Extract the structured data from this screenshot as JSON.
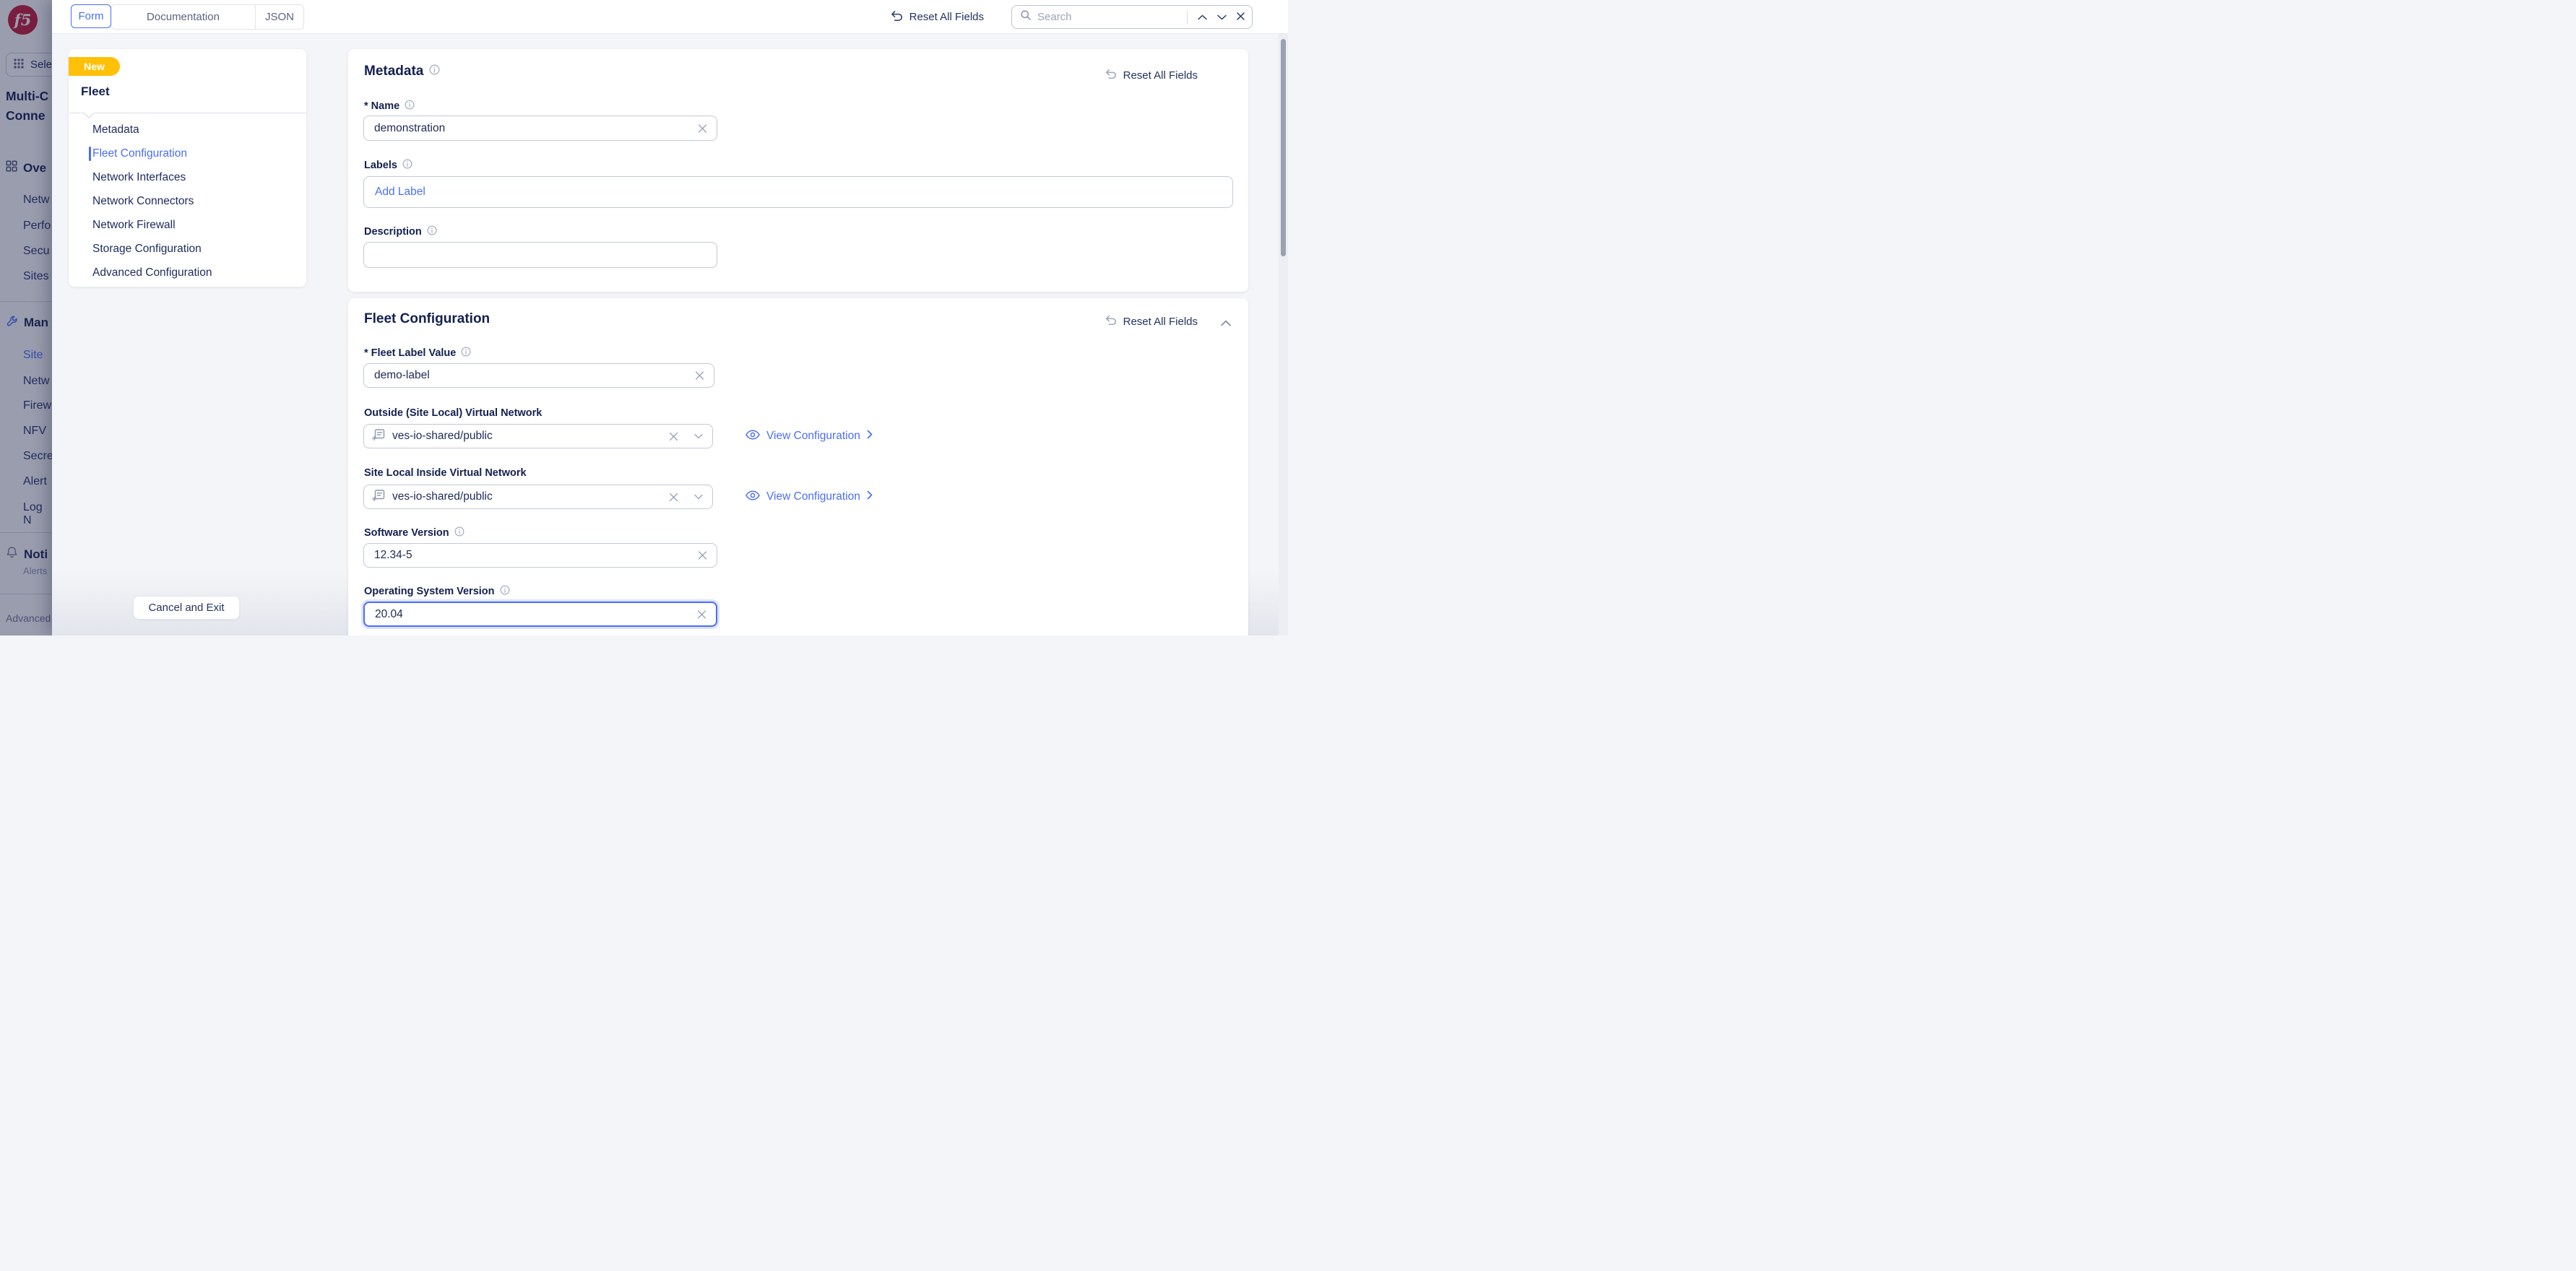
{
  "topbar": {
    "tabs": [
      {
        "label": "Form",
        "active": true
      },
      {
        "label": "Documentation",
        "active": false
      },
      {
        "label": "JSON",
        "active": false
      }
    ],
    "reset_all_label": "Reset All Fields",
    "search": {
      "placeholder": "Search"
    }
  },
  "app_sidebar": {
    "logo_text": "f5",
    "app_switcher_label": "Sele",
    "workspace_title_line1": "Multi-C",
    "workspace_title_line2": "Conne",
    "group_overview": {
      "heading": "Ove",
      "items": [
        {
          "label": "Netw"
        },
        {
          "label": "Perfo"
        },
        {
          "label": "Secu"
        },
        {
          "label": "Sites"
        }
      ]
    },
    "group_manage": {
      "heading": "Man",
      "items": [
        {
          "label": "Site",
          "active": true
        },
        {
          "label": "Netw"
        },
        {
          "label": "Firew"
        },
        {
          "label": "NFV"
        },
        {
          "label": "Secre"
        },
        {
          "label": "Alert"
        },
        {
          "label": "Log N"
        }
      ]
    },
    "group_notifications": {
      "heading": "Noti",
      "subtitle": "Alerts"
    },
    "footer_label": "Advanced"
  },
  "form_nav": {
    "badge": "New",
    "title": "Fleet",
    "items": [
      {
        "label": "Metadata",
        "active": false
      },
      {
        "label": "Fleet Configuration",
        "active": true
      },
      {
        "label": "Network Interfaces",
        "active": false
      },
      {
        "label": "Network Connectors",
        "active": false
      },
      {
        "label": "Network Firewall",
        "active": false
      },
      {
        "label": "Storage Configuration",
        "active": false
      },
      {
        "label": "Advanced Configuration",
        "active": false
      }
    ],
    "cancel_label": "Cancel and Exit"
  },
  "metadata_section": {
    "title": "Metadata",
    "reset_label": "Reset All Fields",
    "name": {
      "label": "* Name",
      "value": "demonstration"
    },
    "labels": {
      "label": "Labels",
      "placeholder": "Add Label"
    },
    "description": {
      "label": "Description",
      "value": ""
    }
  },
  "fleet_section": {
    "title": "Fleet Configuration",
    "reset_label": "Reset All Fields",
    "fleet_label": {
      "label": "* Fleet Label Value",
      "value": "demo-label"
    },
    "outside_vn": {
      "label": "Outside (Site Local) Virtual Network",
      "value": "ves-io-shared/public",
      "action_label": "View Configuration"
    },
    "inside_vn": {
      "label": "Site Local Inside Virtual Network",
      "value": "ves-io-shared/public",
      "action_label": "View Configuration"
    },
    "software_version": {
      "label": "Software Version",
      "value": "12.34-5"
    },
    "os_version": {
      "label": "Operating System Version",
      "value": "20.04"
    }
  },
  "colors": {
    "accent_blue": "#4C6EF5",
    "badge_yellow": "#FFC107",
    "brand_red": "#C41634",
    "navy_text": "#14204F"
  }
}
